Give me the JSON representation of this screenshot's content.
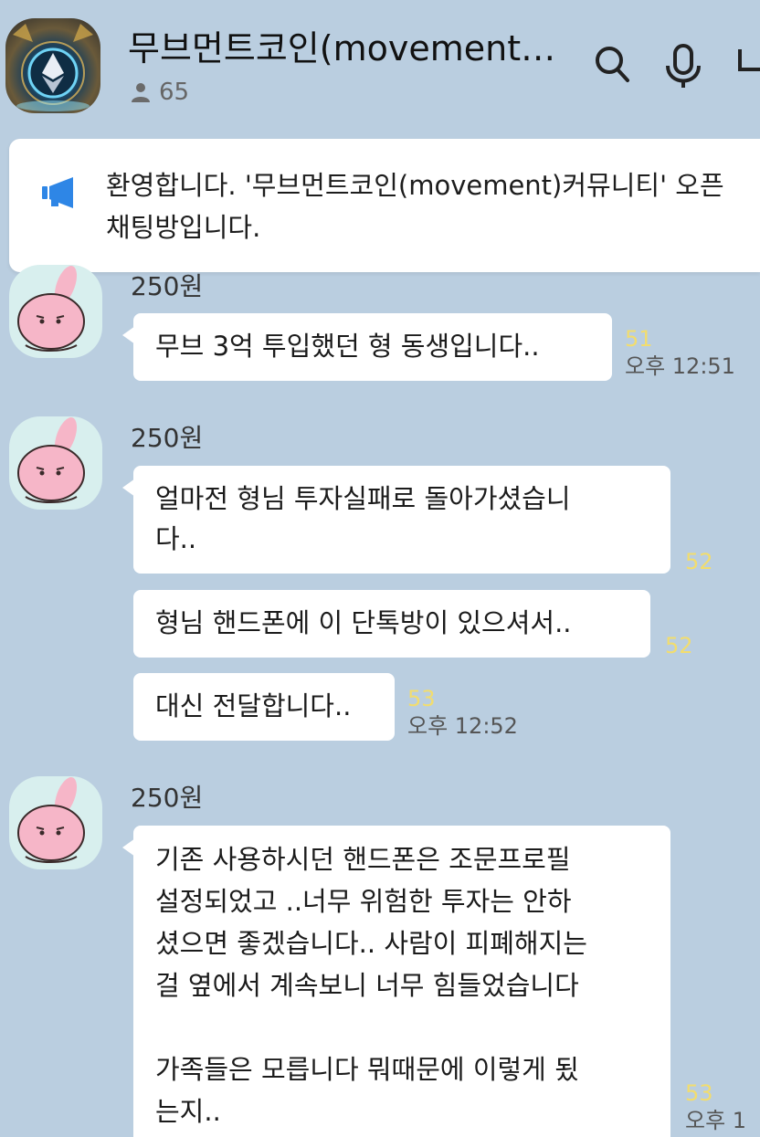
{
  "header": {
    "title": "무브먼트코인(movement)...",
    "member_count": "65",
    "icons": [
      "search-icon",
      "mic-icon",
      "menu-icon"
    ]
  },
  "notice": {
    "text": "환영합니다. '무브먼트코인(movement)커뮤니티' 오픈채팅방입니다."
  },
  "messages": [
    {
      "sender": "250원",
      "bubbles": [
        {
          "text": "무브 3억 투입했던 형 동생입니다..",
          "unread": "51",
          "time": "오후 12:51"
        }
      ]
    },
    {
      "sender": "250원",
      "bubbles": [
        {
          "line1": "얼마전 형님 투자실패로 돌아가셨습니",
          "line2": "다..",
          "unread": "52"
        },
        {
          "text": "형님 핸드폰에 이 단톡방이 있으셔서..",
          "unread": "52"
        },
        {
          "text": "대신 전달합니다..",
          "unread": "53",
          "time": "오후 12:52"
        }
      ]
    },
    {
      "sender": "250원",
      "bubbles": [
        {
          "lines": [
            "기존 사용하시던 핸드폰은 조문프로필",
            "설정되었고 ..너무 위험한 투자는 안하",
            "셨으면 좋겠습니다.. 사람이 피폐해지는",
            "걸 옆에서 계속보니 너무 힘들었습니다",
            "",
            "가족들은 모릅니다 뭐때문에 이렇게 됬",
            "는지.."
          ],
          "unread": "53",
          "time": "오후 1"
        }
      ]
    }
  ],
  "colors": {
    "background": "#bacee0",
    "bubble": "#ffffff",
    "unread": "#f2dd6e",
    "notice_icon": "#2e86e6"
  }
}
